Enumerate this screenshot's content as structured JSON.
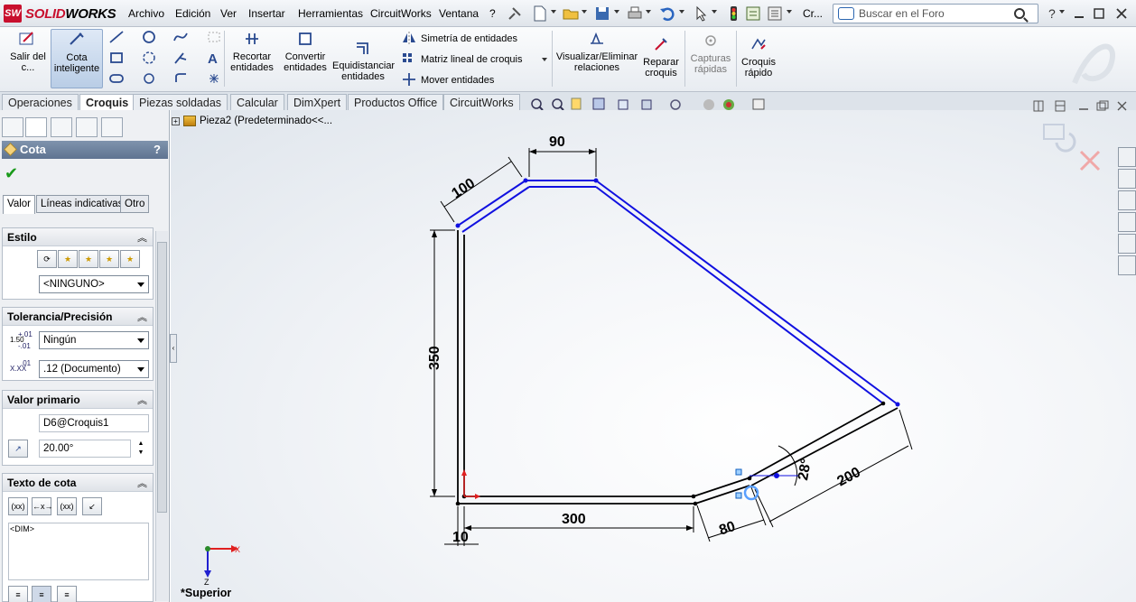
{
  "app": {
    "name_a": "SOLID",
    "name_b": "WORKS",
    "logo_mark": "SW"
  },
  "menu": [
    "Archivo",
    "Edición",
    "Ver",
    "Insertar",
    "Herramientas",
    "CircuitWorks",
    "Ventana",
    "?"
  ],
  "toolbar_overflow": "Cr...",
  "search": {
    "placeholder": "Buscar en el Foro"
  },
  "ribbon": {
    "exit_sketch": "Salir del c...",
    "smart_dim": "Cota inteligente",
    "trim": "Recortar entidades",
    "convert": "Convertir entidades",
    "offset": "Equidistanciar entidades",
    "mirror": "Simetría de entidades",
    "linear_pattern": "Matriz lineal de croquis",
    "move": "Mover entidades",
    "relations": "Visualizar/Eliminar relaciones",
    "repair": "Reparar croquis",
    "snaps": "Capturas rápidas",
    "rapid": "Croquis rápido"
  },
  "tabs": [
    "Operaciones",
    "Croquis",
    "Piezas soldadas",
    "Calcular",
    "DimXpert",
    "Productos Office",
    "CircuitWorks"
  ],
  "active_tab": "Croquis",
  "tree": {
    "label": "Pieza2  (Predeterminado<<..."
  },
  "pm": {
    "title": "Cota",
    "help": "?",
    "tabs": [
      "Valor",
      "Líneas indicativas",
      "Otro"
    ],
    "style": {
      "title": "Estilo",
      "combo": "<NINGUNO>"
    },
    "tolerance": {
      "title": "Tolerancia/Precisión",
      "tol_type": "Ningún",
      "precision": ".12 (Documento)",
      "tol_icon_main": "1.50",
      "tol_icon_up": "+.01",
      "tol_icon_down": "-.01",
      "prec_icon_main": "X.XX",
      "prec_icon_up": ".01"
    },
    "primary": {
      "title": "Valor primario",
      "name": "D6@Croquis1",
      "value": "20.00°"
    },
    "dimtext": {
      "title": "Texto de cota",
      "buttons": [
        "(xx)",
        "←x→",
        "(xx)",
        ""
      ],
      "text": "<DIM>"
    }
  },
  "view": {
    "name": "*Superior"
  },
  "dimensions": {
    "top": "90",
    "slant": "100",
    "left": "350",
    "bottom": "300",
    "thickness": "10",
    "short": "80",
    "long": "200",
    "angle": "28°"
  },
  "triad": {
    "x": "X",
    "z": "Z"
  },
  "colors": {
    "sketch_selected": "#1010e0",
    "sketch": "#000000",
    "accent_red": "#e02020"
  }
}
